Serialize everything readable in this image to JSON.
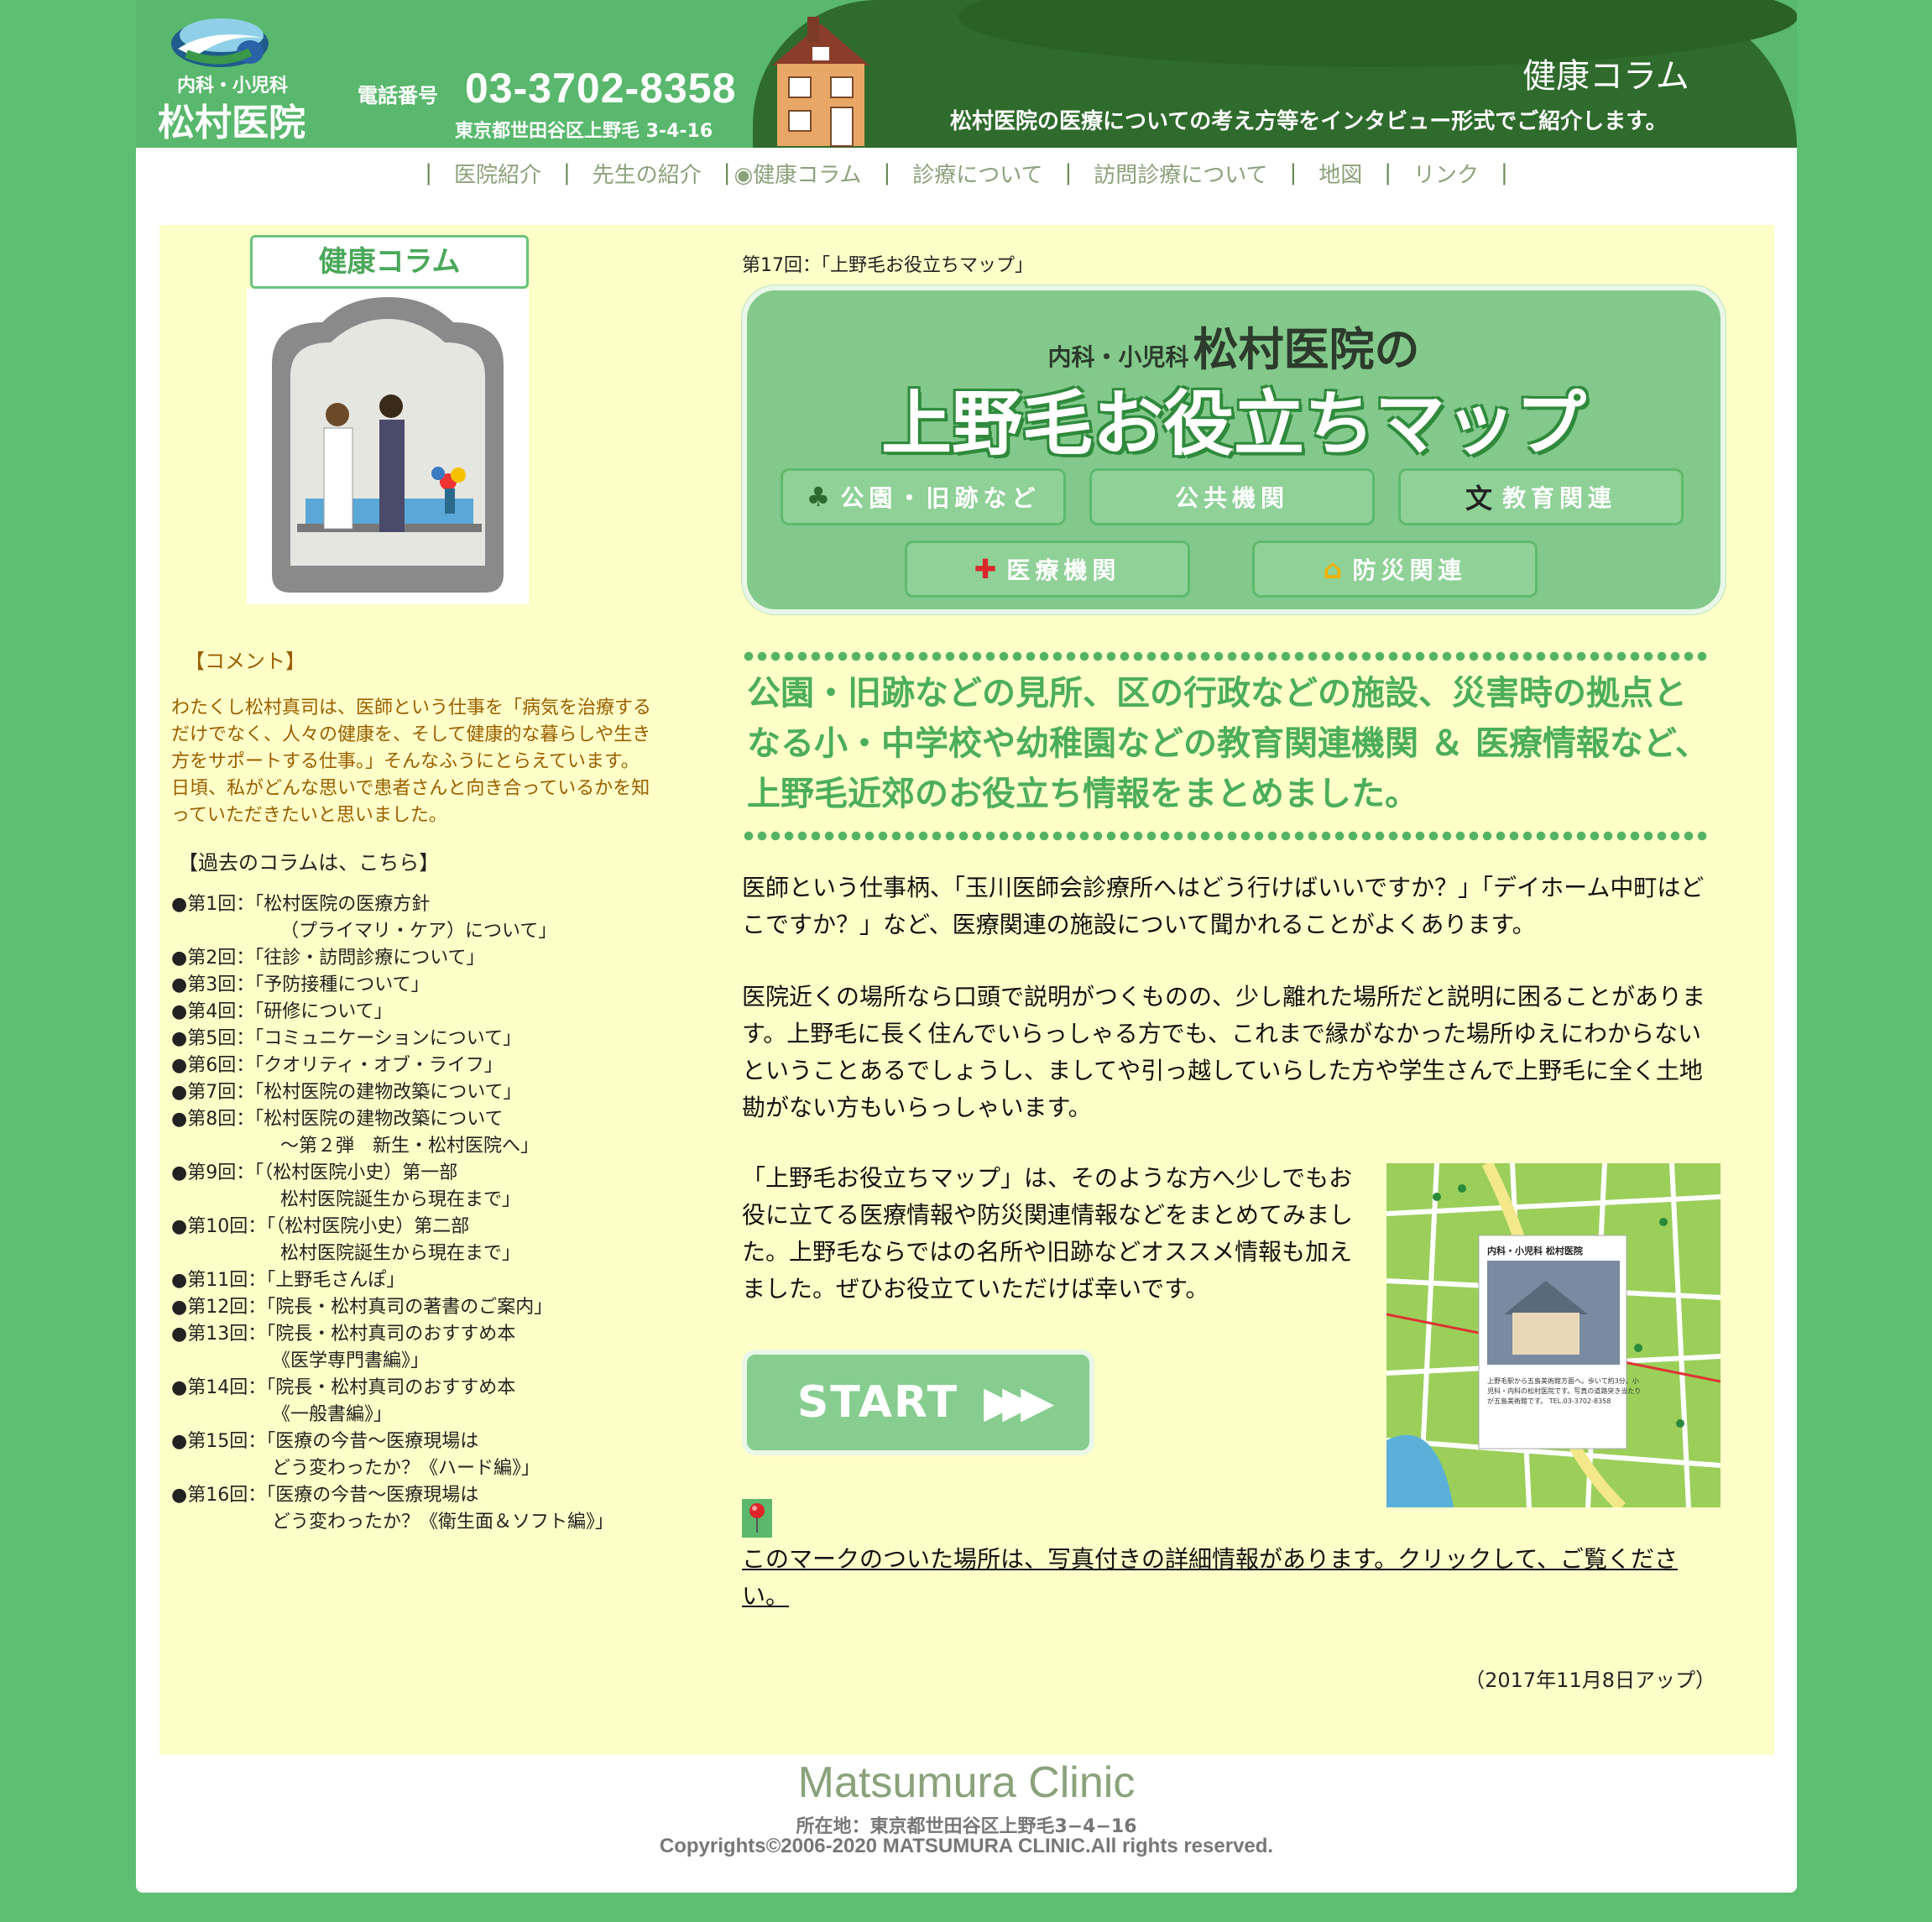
{
  "header": {
    "logo_sub": "内科・小児科",
    "logo_name": "松村医院",
    "tel_label": "電話番号",
    "tel_number": "03-3702-8358",
    "address": "東京都世田谷区上野毛 3-4-16",
    "section_title": "健康コラム",
    "section_desc": "松村医院の医療についての考え方等をインタビュー形式でご紹介します。"
  },
  "nav": {
    "items": [
      "医院紹介",
      "先生の紹介",
      "◉健康コラム",
      "診療について",
      "訪問診療について",
      "地図",
      "リンク"
    ],
    "separator": "|"
  },
  "sidebar": {
    "title": "健康コラム",
    "comment_heading": "【コメント】",
    "comment_text": "わたくし松村真司は、医師という仕事を「病気を治療するだけでなく、人々の健康を、そして健康的な暮らしや生き方をサポートする仕事。」そんなふうにとらえています。 日頃、私がどんな思いで患者さんと向き合っているかを知っていただきたいと思いました。",
    "past_heading": "【過去のコラムは、こちら】",
    "past": [
      {
        "line1": "●第1回：「松村医院の医療方針",
        "line2": "（プライマリ・ケア）について」"
      },
      {
        "line1": "●第2回：「往診・訪問診療について」"
      },
      {
        "line1": "●第3回：「予防接種について」"
      },
      {
        "line1": "●第4回：「研修について」"
      },
      {
        "line1": "●第5回：「コミュニケーションについて」"
      },
      {
        "line1": "●第6回：「クオリティ・オブ・ライフ」"
      },
      {
        "line1": "●第7回：「松村医院の建物改築について」"
      },
      {
        "line1": "●第8回：「松村医院の建物改築について",
        "line2": "～第２弾　新生・松村医院へ」"
      },
      {
        "line1": "●第9回：「（松村医院小史）第一部",
        "line2": "松村医院誕生から現在まで」"
      },
      {
        "line1": "●第10回：「（松村医院小史）第二部",
        "line2": "松村医院誕生から現在まで」"
      },
      {
        "line1": "●第11回：「上野毛さんぽ」"
      },
      {
        "line1": "●第12回：「院長・松村真司の著書のご案内」"
      },
      {
        "line1": "●第13回：「院長・松村真司のおすすめ本",
        "line2": "《医学専門書編》」"
      },
      {
        "line1": "●第14回：「院長・松村真司のおすすめ本",
        "line2": "《一般書編》」"
      },
      {
        "line1": "●第15回：「医療の今昔～医療現場は",
        "line2": "どう変わったか？《ハード編》」"
      },
      {
        "line1": "●第16回：「医療の今昔～医療現場は",
        "line2": "どう変わったか？《衛生面＆ソフト編》」"
      }
    ]
  },
  "main": {
    "episode_title": "第17回：「上野毛お役立ちマップ」",
    "banner": {
      "sub_small": "内科・小児科",
      "sub_large": "松村医院の",
      "title": "上野毛お役立ちマップ",
      "buttons": [
        "公園・旧跡など",
        "公共機関",
        "教育関連",
        "医療機関",
        "防災関連"
      ],
      "edu_icon": "文"
    },
    "intro": "公園・旧跡などの見所、区の行政などの施設、災害時の拠点となる小・中学校や幼稚園などの教育関連機関 ＆ 医療情報など、上野毛近郊のお役立ち情報をまとめました。",
    "para1": "医師という仕事柄、「玉川医師会診療所へはどう行けばいいですか？」「デイホーム中町はどこですか？」など、医療関連の施設について聞かれることがよくあります。",
    "para2": "医院近くの場所なら口頭で説明がつくものの、少し離れた場所だと説明に困ることがあります。上野毛に長く住んでいらっしゃる方でも、これまで縁がなかった場所ゆえにわからないということあるでしょうし、ましてや引っ越していらした方や学生さんで上野毛に全く土地勘がない方もいらっしゃいます。",
    "para3": "「上野毛お役立ちマップ」は、そのような方へ少しでもお役に立てる医療情報や防災関連情報などをまとめてみました。上野毛ならではの名所や旧跡などオススメ情報も加えました。ぜひお役立ていただけば幸いです。",
    "start_label": "START",
    "map_popup_title": "内科・小児科 松村医院",
    "map_popup_text": "上野毛駅から五島美術館方面へ。歩いて約3分。小児科・内科の松村医院です。写真の道路突き当たりが五島美術館です。 TEL.03-3702-8358",
    "pin_text": "このマークのついた場所は、写真付きの詳細情報があります。クリックして、ご覧ください。",
    "update": "（2017年11月8日アップ）"
  },
  "footer": {
    "name": "Matsumura Clinic",
    "address": "所在地：東京都世田谷区上野毛3−4−16",
    "copyright": "Copyrights©2006-2020 MATSUMURA CLINIC.All rights reserved."
  }
}
